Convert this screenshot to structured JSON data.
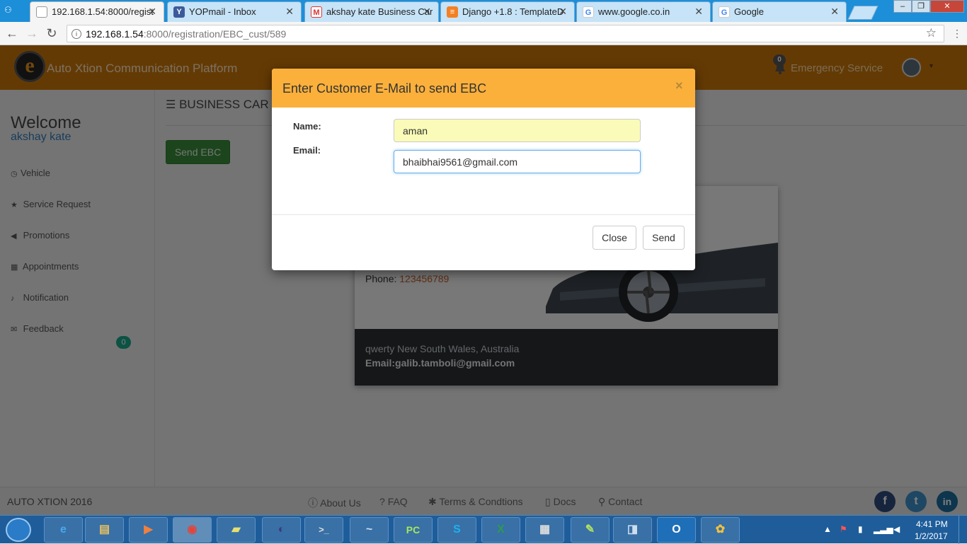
{
  "browser": {
    "tabs": [
      {
        "title": "192.168.1.54:8000/regist",
        "favicon": "page-icon",
        "active": true
      },
      {
        "title": "YOPmail - Inbox",
        "favicon": "yopmail-icon"
      },
      {
        "title": "akshay kate Business Car",
        "favicon": "gmail-icon"
      },
      {
        "title": "Django +1.8 : TemplateD",
        "favicon": "stackoverflow-icon"
      },
      {
        "title": "www.google.co.in",
        "favicon": "google-icon"
      },
      {
        "title": "Google",
        "favicon": "google-icon"
      }
    ],
    "url_host": "192.168.1.54",
    "url_rest": ":8000/registration/EBC_cust/589"
  },
  "header": {
    "brand": "Auto Xtion Communication Platform",
    "notification_count": "0",
    "emergency": "Emergency Service"
  },
  "sidebar": {
    "welcome": "Welcome",
    "username": "akshay kate",
    "items": [
      {
        "label": "Vehicle",
        "icon": "dashboard-icon"
      },
      {
        "label": "Service Request",
        "icon": "star-icon"
      },
      {
        "label": "Promotions",
        "icon": "bullhorn-icon"
      },
      {
        "label": "Appointments",
        "icon": "calendar-icon"
      },
      {
        "label": "Notification",
        "icon": "bell-icon"
      },
      {
        "label": "Feedback",
        "icon": "envelope-icon"
      }
    ],
    "notification_badge": "0"
  },
  "main": {
    "title": "BUSINESS CAR",
    "send_button": "Send EBC",
    "card": {
      "phone_label": "Phone: ",
      "phone": "123456789",
      "address": "qwerty New South Wales, Australia",
      "email": "Email:galib.tamboli@gmail.com"
    }
  },
  "modal": {
    "title": "Enter Customer E-Mail to send EBC",
    "close_x": "×",
    "name_label": "Name:",
    "name_value": "aman",
    "email_label": "Email:",
    "email_value": "bhaibhai9561@gmail.com",
    "close_button": "Close",
    "send_button": "Send"
  },
  "footer": {
    "copyright": "AUTO XTION 2016",
    "links": [
      "About Us",
      "FAQ",
      "Terms & Condtions",
      "Docs",
      "Contact"
    ],
    "social": [
      "f",
      "t",
      "in"
    ]
  },
  "taskbar": {
    "time": "4:41 PM",
    "date": "1/2/2017",
    "apps": [
      "e",
      "▤",
      "▶",
      "◉",
      "▰",
      "◐",
      ">_",
      "~",
      "PC",
      "S",
      "X",
      "▦",
      "✎",
      "◨",
      "O",
      "✿"
    ]
  },
  "colors": {
    "header": "#c97408",
    "modal_header": "#fbb03b",
    "send_ebc": "#3a8a3a",
    "badge": "#1aa589"
  }
}
